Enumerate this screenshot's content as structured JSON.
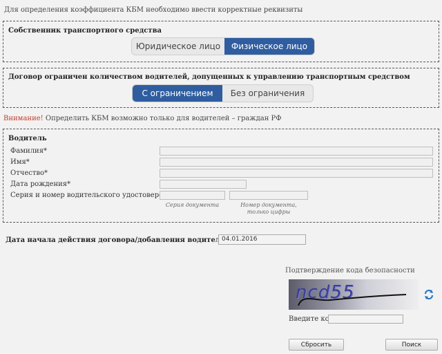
{
  "intro": "Для определения коэффициента КБМ необходимо ввести корректные реквизиты",
  "owner": {
    "title": "Собственник транспортного средства",
    "options": [
      "Юридическое лицо",
      "Физическое лицо"
    ],
    "selected": "Физическое лицо"
  },
  "contract": {
    "title": "Договор ограничен количеством водителей, допущенных к управлению транспортным средством",
    "options": [
      "С ограничением",
      "Без ограничения"
    ],
    "selected": "С ограничением"
  },
  "warning": {
    "prefix": "Внимание!",
    "text": " Определить КБМ возможно только для водителей – граждан РФ"
  },
  "driver": {
    "title": "Водитель",
    "surname_label": "Фамилия*",
    "name_label": "Имя*",
    "patronymic_label": "Отчество*",
    "birthdate_label": "Дата рождения*",
    "license_label": "Серия и номер водительского удостоверения*",
    "series_hint": "Серия документа",
    "number_hint": "Номер документа, только цифры"
  },
  "start_date": {
    "label": "Дата начала действия договора/добавления водителя в договор",
    "value": "04.01.2016"
  },
  "captcha": {
    "title": "Подтверждение кода безопасности",
    "image_text": "ncd55",
    "code_label": "Введите код:",
    "refresh_icon": "refresh-icon"
  },
  "buttons": {
    "reset": "Сбросить",
    "search": "Поиск"
  },
  "colors": {
    "accent": "#2f5da0",
    "warning": "#c0392b"
  }
}
